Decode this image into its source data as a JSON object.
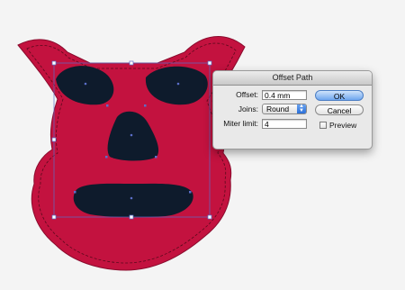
{
  "dialog": {
    "title": "Offset Path",
    "offset_label": "Offset:",
    "offset_value": "0.4 mm",
    "joins_label": "Joins:",
    "joins_value": "Round",
    "miter_label": "Miter limit:",
    "miter_value": "4",
    "ok_label": "OK",
    "cancel_label": "Cancel",
    "preview_label": "Preview"
  },
  "colors": {
    "mask": "#c3123f",
    "mask_stroke": "#8a0b2d",
    "cutout": "#0e1b2c",
    "selection": "#5b6fc9",
    "ok_button": "#6ea6ef"
  }
}
